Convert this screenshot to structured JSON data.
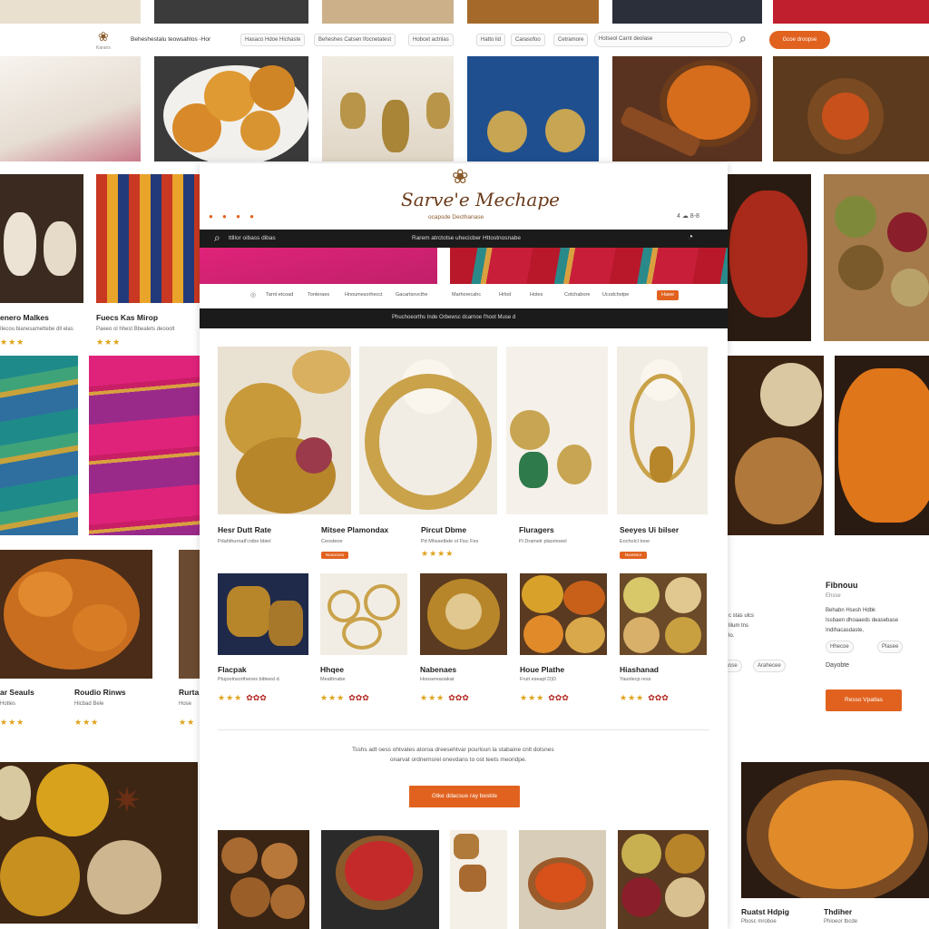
{
  "topnav": {
    "brand_tag": "Karans",
    "tagline": "Beheshestalu teowsahlos -Hor",
    "pills": [
      "Hasaco Hdoe Hichaste",
      "Beheshes Catsen Ifocnetatest",
      "Hobcet actnlas",
      "Hatto lid",
      "Carasofoo",
      "Cetramore",
      "Hotseol Carnt deolase"
    ],
    "search_icon": "magnifier-icon",
    "cta": "Gcoe droopse"
  },
  "left_products": [
    {
      "title": "enero Malkes",
      "desc": "Ilecou bianesamettebe dll elas",
      "stars": "★★★"
    },
    {
      "title": "Fuecs Kas Mirop",
      "desc": "Paeeo ol hhest Bbealets deooolt",
      "stars": "★★★"
    }
  ],
  "left_bottom": [
    {
      "title": "ar Seauls",
      "desc": "Hotles",
      "stars": "★★★"
    },
    {
      "title": "Roudio Rinws",
      "desc": "Hicbad Bele",
      "stars": "★★★"
    },
    {
      "title": "Rurta",
      "desc": "Hose",
      "stars": "★★"
    }
  ],
  "main": {
    "logo": "Sarve'e Mechape",
    "subtitle": "ocapsde Decthanase",
    "header_icons": "4  ☁ 8-8",
    "dots": "● ● ● ●",
    "search_placeholder": "ttlllor oibass dibas",
    "search_center": "Rarem atrctotse uhecicber Httostnosnabe",
    "nav": [
      "Tarnt etcoad",
      "Tonteraes",
      "Hnoumesorhecct",
      "Gacartsovcthe",
      "Marhorecahc",
      "Hrlod",
      "Hotes",
      "Cotchabore",
      "Ucodchotpe",
      "Hawe"
    ],
    "banner": "Phuchoeorths Inde  Orbewsc dcarnoe l'hoot Muse d",
    "cards": [
      {
        "title": "Hesr Dutt Rate",
        "desc": "Pdahthurnatl'coibe bbiel",
        "badge": ""
      },
      {
        "title": "Mitsee Plamondax",
        "desc": "Ceosteoe",
        "badge": "Nooocoso"
      },
      {
        "title": "Pircut Dbme",
        "desc": "Pd Mhssetbde ol Fisc Fes",
        "badge": "★★★★"
      },
      {
        "title": "Fluragers",
        "desc": "Pi Dramelr plasmoeel",
        "badge": ""
      },
      {
        "title": "Seeyes Ui bilser",
        "desc": "Eocholcl tooe",
        "badge": "Nooresor"
      }
    ],
    "cards2": [
      {
        "title": "Flacpak",
        "desc": "Ptujoolnsorthenes bitteesl d.",
        "stars": "★★★",
        "hearts": "✿✿✿"
      },
      {
        "title": "Hhqee",
        "desc": "Meathnabe",
        "stars": "★★★",
        "hearts": "✿✿✿"
      },
      {
        "title": "Nabenaes",
        "desc": "Hoosereaoakat",
        "stars": "★★★",
        "hearts": "✿✿✿"
      },
      {
        "title": "Houe Plathe",
        "desc": "Fruit eseapl D)D",
        "stars": "★★★",
        "hearts": "✿✿✿"
      },
      {
        "title": "Hiashanad",
        "desc": "Yaunlecp ress",
        "stars": "★★★",
        "hearts": "✿✿✿"
      }
    ],
    "blurb_line1": "Tsshs adt oess ohtvates atoroa dreesehtvar pourloun la stabaine cnlt dotsnes",
    "blurb_line2": "onarvat ordnemsrel onevdans to ost teets meoridpe.",
    "cta": "Gtke ddacsue ray beskte"
  },
  "right_panel": {
    "title": "Fibnouu",
    "tag": "Ehsse",
    "lines": [
      "Behabn Hsesh Hdbk",
      "Issbaen dhoaaeds deasebase",
      "Indihacasdaste,"
    ],
    "pills": [
      "Hhecoe",
      "Plasee"
    ],
    "label": "Dayobte",
    "cta": "Resso Vpatlas",
    "frag_lines": [
      "c stas ulcs",
      "lilum tns",
      "lo."
    ],
    "frag_pills": [
      "Ibcose",
      "Arahecee"
    ]
  },
  "bottom_right": [
    {
      "title": "Ruatst Hdpig",
      "desc": "Pbosc mroboe"
    },
    {
      "title": "Thdiher",
      "desc": "Phioeor tbcde"
    }
  ],
  "colors": {
    "accent": "#e1621f",
    "dark_bar": "#1b1b1b",
    "star": "#e0a21a"
  }
}
